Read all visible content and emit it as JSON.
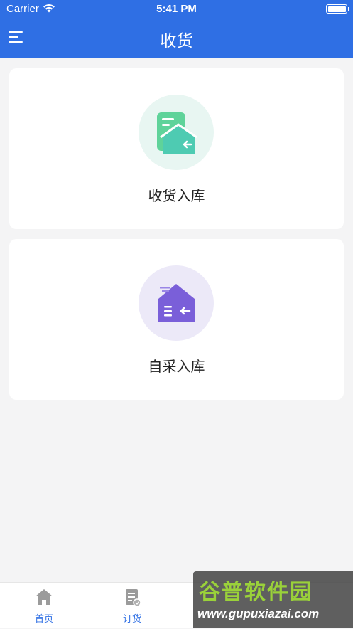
{
  "status_bar": {
    "carrier": "Carrier",
    "time": "5:41 PM"
  },
  "header": {
    "title": "收货"
  },
  "cards": [
    {
      "label": "收货入库",
      "icon": "receive-warehouse-icon",
      "color": "#4ecbb2"
    },
    {
      "label": "自采入库",
      "icon": "self-purchase-warehouse-icon",
      "color": "#7a5fd9"
    }
  ],
  "tabbar": {
    "items": [
      {
        "label": "首页",
        "icon": "home-icon"
      },
      {
        "label": "订货",
        "icon": "order-icon"
      }
    ]
  },
  "watermark": {
    "line1": "谷普软件园",
    "line2": "www.gupuxiazai.com"
  },
  "colors": {
    "primary": "#2f6fe4",
    "background": "#f4f4f5"
  }
}
